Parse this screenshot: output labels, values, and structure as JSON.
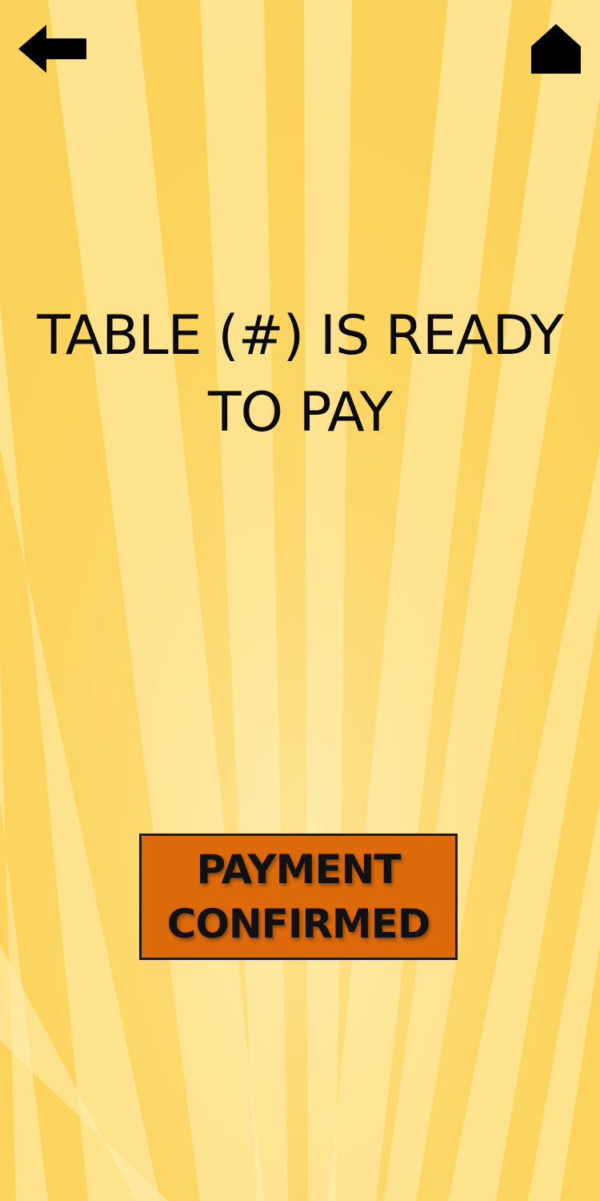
{
  "screen": {
    "background": "#fdd65c",
    "ray_color": "#fff6cc",
    "accent": "#dc6a0b"
  },
  "nav": {
    "back_icon": "left-arrow-icon",
    "home_icon": "home-icon"
  },
  "message": {
    "line1": "TABLE (#) IS READY",
    "line2": "TO PAY"
  },
  "confirm": {
    "line1": "PAYMENT",
    "line2": "CONFIRMED"
  }
}
